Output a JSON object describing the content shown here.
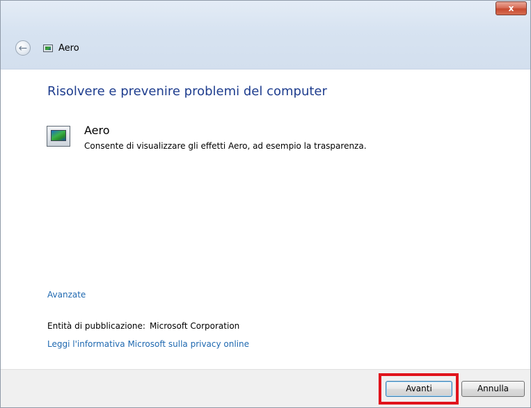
{
  "window": {
    "close_glyph": "x",
    "title": "Aero"
  },
  "nav": {
    "back_glyph": "←",
    "app_icon": "aero-app-icon"
  },
  "content": {
    "heading": "Risolvere e prevenire problemi del computer",
    "item": {
      "icon": "aero-troubleshooter-icon",
      "title": "Aero",
      "description": "Consente di visualizzare gli effetti Aero, ad esempio la trasparenza."
    },
    "advanced_link": "Avanzate",
    "publisher_label": "Entità di pubblicazione:",
    "publisher_value": "Microsoft Corporation",
    "privacy_link": "Leggi l'informativa Microsoft sulla privacy online"
  },
  "footer": {
    "next_label": "Avanti",
    "cancel_label": "Annulla"
  },
  "colors": {
    "heading": "#1e3d8e",
    "link": "#1e68b0",
    "highlight": "#e0141c"
  }
}
